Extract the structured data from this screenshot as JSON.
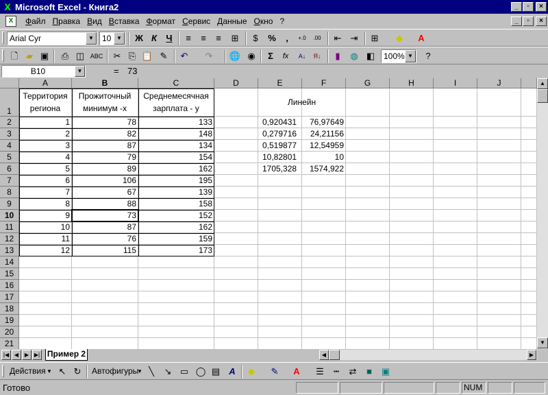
{
  "window": {
    "title": "Microsoft Excel - Книга2"
  },
  "menu": {
    "items": [
      "Файл",
      "Правка",
      "Вид",
      "Вставка",
      "Формат",
      "Сервис",
      "Данные",
      "Окно",
      "?"
    ]
  },
  "format_toolbar": {
    "font_name": "Arial Cyr",
    "font_size": "10",
    "bold": "Ж",
    "italic": "К",
    "underline": "Ч",
    "percent": "%",
    "comma": ","
  },
  "standard_toolbar": {
    "zoom": "100%",
    "sum": "Σ",
    "fx": "fx"
  },
  "formula_bar": {
    "name_box": "B10",
    "equals": "=",
    "value": "73"
  },
  "columns": [
    "A",
    "B",
    "C",
    "D",
    "E",
    "F",
    "G",
    "H",
    "I",
    "J"
  ],
  "rows": [
    "1",
    "2",
    "3",
    "4",
    "5",
    "6",
    "7",
    "8",
    "9",
    "10",
    "11",
    "12",
    "13",
    "14",
    "15",
    "16",
    "17",
    "18",
    "19",
    "20",
    "21"
  ],
  "headers": {
    "a": "Территория региона",
    "b": "Прожиточный минимум -х",
    "c": "Среднемесячная зарплата - у"
  },
  "table": [
    [
      "1",
      "78",
      "133"
    ],
    [
      "2",
      "82",
      "148"
    ],
    [
      "3",
      "87",
      "134"
    ],
    [
      "4",
      "79",
      "154"
    ],
    [
      "5",
      "89",
      "162"
    ],
    [
      "6",
      "106",
      "195"
    ],
    [
      "7",
      "67",
      "139"
    ],
    [
      "8",
      "88",
      "158"
    ],
    [
      "9",
      "73",
      "152"
    ],
    [
      "10",
      "87",
      "162"
    ],
    [
      "11",
      "76",
      "159"
    ],
    [
      "12",
      "115",
      "173"
    ]
  ],
  "linest": {
    "label": "Линейн",
    "values": [
      [
        "0,920431",
        "76,97649"
      ],
      [
        "0,279716",
        "24,21156"
      ],
      [
        "0,519877",
        "12,54959"
      ],
      [
        "10,82801",
        "10"
      ],
      [
        "1705,328",
        "1574,922"
      ]
    ]
  },
  "sheet_tab": "Пример 2",
  "drawing_toolbar": {
    "actions": "Действия",
    "autoshapes": "Автофигуры"
  },
  "status": {
    "text": "Готово",
    "num": "NUM"
  }
}
